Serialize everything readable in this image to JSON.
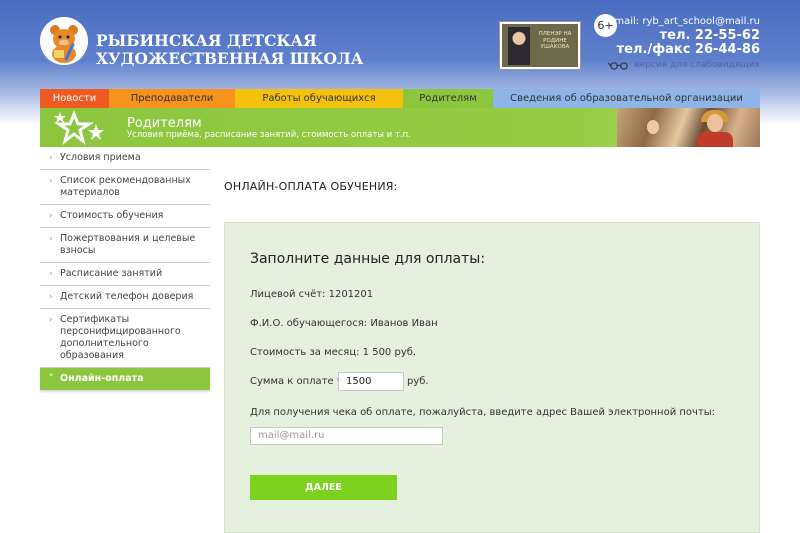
{
  "header": {
    "school_name_line1": "Рыбинская детская",
    "school_name_line2": "художественная школа",
    "banner_text": "Пленэр на родине Ушакова",
    "age_rating": "6+",
    "email": "email: ryb_art_school@mail.ru",
    "phone1": "тел. 22-55-62",
    "phone2": "тел./факс 26-44-86",
    "low_vision": "версия для слабовидящих"
  },
  "nav": {
    "items": [
      {
        "label": "Новости"
      },
      {
        "label": "Преподаватели"
      },
      {
        "label": "Работы обучающихся"
      },
      {
        "label": "Родителям"
      },
      {
        "label": "Сведения об образовательной организации"
      }
    ]
  },
  "section": {
    "title": "Родителям",
    "subtitle": "Условия приёма, расписание занятий, стоимость оплаты и т.п."
  },
  "sidebar": {
    "items": [
      {
        "label": "Условия приема"
      },
      {
        "label": "Список рекомендованных материалов"
      },
      {
        "label": "Стоимость обучения"
      },
      {
        "label": "Пожертвования и целевые взносы"
      },
      {
        "label": "Расписание занятий"
      },
      {
        "label": "Детский телефон доверия"
      },
      {
        "label": "Сертификаты персонифицированного дополнительного образования"
      },
      {
        "label": "Онлайн-оплата"
      }
    ],
    "active_index": 7
  },
  "main": {
    "heading": "Онлайн-оплата обучения:",
    "form": {
      "title": "Заполните данные для оплаты:",
      "account": "Лицевой счёт: 1201201",
      "student": "Ф.И.О. обучающегося: Иванов Иван",
      "monthly_cost": "Стоимость за месяц: 1 500 руб.",
      "sum_label": "Сумма к оплате *",
      "sum_value": "1500",
      "sum_unit": "руб.",
      "email_prompt": "Для получения чека об оплате, пожалуйста, введите адрес Вашей электронной почты:",
      "email_placeholder": "mail@mail.ru",
      "submit_label": "Далее"
    }
  },
  "colors": {
    "accent_green": "#8cc63f",
    "button_green": "#7dd21e",
    "form_bg": "#e6f0de",
    "nav_news": "#ef5a22",
    "nav_teachers": "#f7931d",
    "nav_works": "#f4c20d",
    "nav_parents": "#8cc63f",
    "nav_info": "#8eb4e8"
  }
}
